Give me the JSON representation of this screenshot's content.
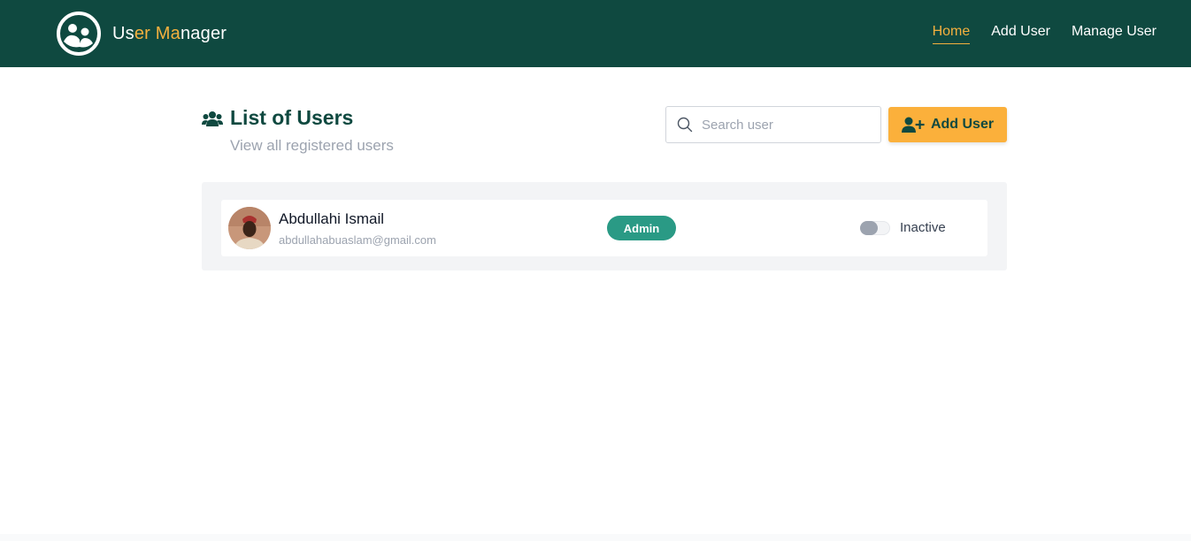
{
  "brand": {
    "parts": [
      "Us",
      "er Ma",
      "nager"
    ],
    "accent_color": "#f4b03e",
    "logo_icon": "users-circle-logo-icon"
  },
  "nav": {
    "items": [
      {
        "label": "Home",
        "active": true
      },
      {
        "label": "Add User",
        "active": false
      },
      {
        "label": "Manage User",
        "active": false
      }
    ]
  },
  "header": {
    "title": "List of Users",
    "subtitle": "View all registered users",
    "title_icon": "users-group-icon"
  },
  "search": {
    "placeholder": "Search user",
    "value": "",
    "icon": "search-icon"
  },
  "add_button": {
    "label": "Add User",
    "icon": "user-plus-icon"
  },
  "users": [
    {
      "name": "Abdullahi Ismail",
      "email": "abdullahabuaslam@gmail.com",
      "role": "Admin",
      "status": "Inactive",
      "active": false
    }
  ],
  "colors": {
    "navbar": "#0f4940",
    "accent": "#f4b03e",
    "button": "#fbb03b",
    "badge": "#2a9a85"
  }
}
